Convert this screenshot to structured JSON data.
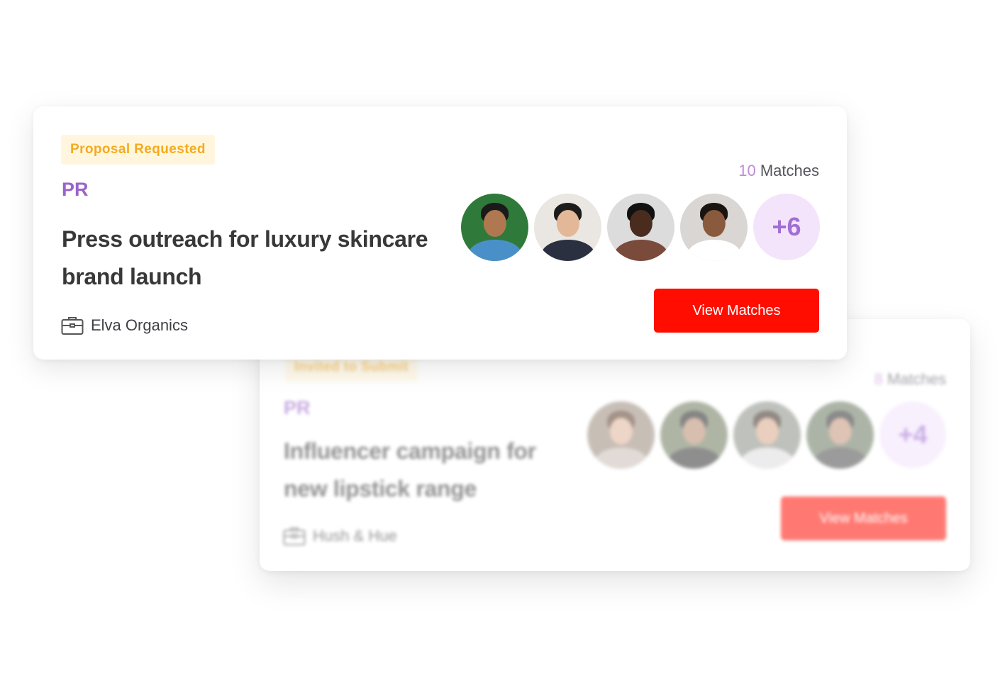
{
  "cards": [
    {
      "status": "Proposal Requested",
      "category": "PR",
      "title_line1": "Press outreach for luxury skincare",
      "title_line2": "brand launch",
      "company": "Elva Organics",
      "match_count": "10",
      "matches_label": "Matches",
      "more_label": "+6",
      "button_label": "View Matches"
    },
    {
      "status": "Invited to Submit",
      "category": "PR",
      "title_line1": "Influencer campaign for",
      "title_line2": "new lipstick range",
      "company": "Hush & Hue",
      "match_count": "8",
      "matches_label": "Matches",
      "more_label": "+4",
      "button_label": "View Matches"
    }
  ],
  "colors": {
    "accent_red": "#ff0d00",
    "badge_bg": "#fff6dd",
    "badge_text": "#f5ab1e",
    "category_purple": "#9a64c8",
    "more_bg": "#f3e4fb"
  },
  "icons": {
    "company": "briefcase-icon"
  }
}
